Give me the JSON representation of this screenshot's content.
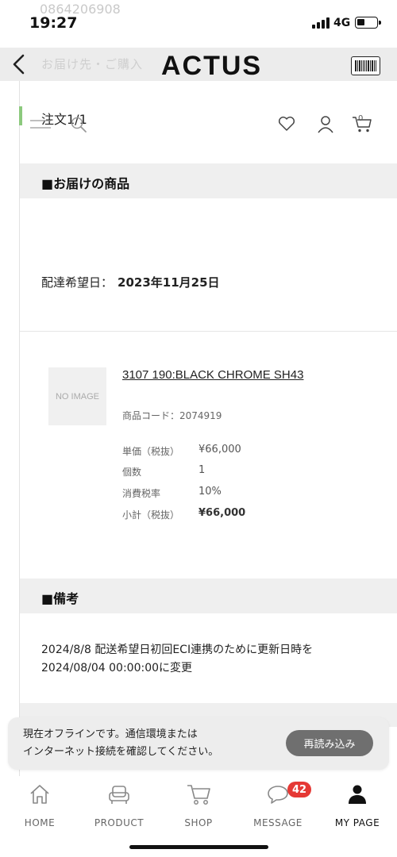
{
  "status_bar": {
    "phone_overlay": "0864206908",
    "time": "19:27",
    "network": "4G"
  },
  "header": {
    "ghost_text": "お届け先・ご購入",
    "logo": "ACTUS"
  },
  "sub_header": {
    "order_title": "注文1/1",
    "cart_count": "0"
  },
  "delivery_section": {
    "heading": "■お届けの商品",
    "date_label": "配達希望日：",
    "date_value": "2023年11月25日"
  },
  "product": {
    "image_placeholder": "NO IMAGE",
    "name": "3107 190:BLACK CHROME SH43",
    "code": "商品コード：2074919",
    "specs": [
      {
        "label": "単価（税抜）",
        "value": "¥66,000"
      },
      {
        "label": "個数",
        "value": "1"
      },
      {
        "label": "消費税率",
        "value": "10%"
      },
      {
        "label": "小計（税抜）",
        "value": "¥66,000"
      }
    ]
  },
  "notes_section": {
    "heading": "■備考",
    "text": "2024/8/8 配送希望日初回ECI連携のために更新日時を2024/08/04 00:00:00に変更"
  },
  "toast": {
    "line1": "現在オフラインです。通信環境または",
    "line2": "インターネット接続を確認してください。",
    "button": "再読み込み"
  },
  "bottom_nav": {
    "items": [
      {
        "label": "HOME",
        "icon": "home-icon"
      },
      {
        "label": "PRODUCT",
        "icon": "sofa-icon"
      },
      {
        "label": "SHOP",
        "icon": "cart-icon"
      },
      {
        "label": "MESSAGE",
        "icon": "chat-icon"
      },
      {
        "label": "MY PAGE",
        "icon": "person-icon"
      }
    ],
    "message_badge": "42",
    "active": "MY PAGE"
  },
  "colors": {
    "accent_green": "#8cc97d",
    "badge_red": "#e53935",
    "section_bg": "#efefef"
  }
}
